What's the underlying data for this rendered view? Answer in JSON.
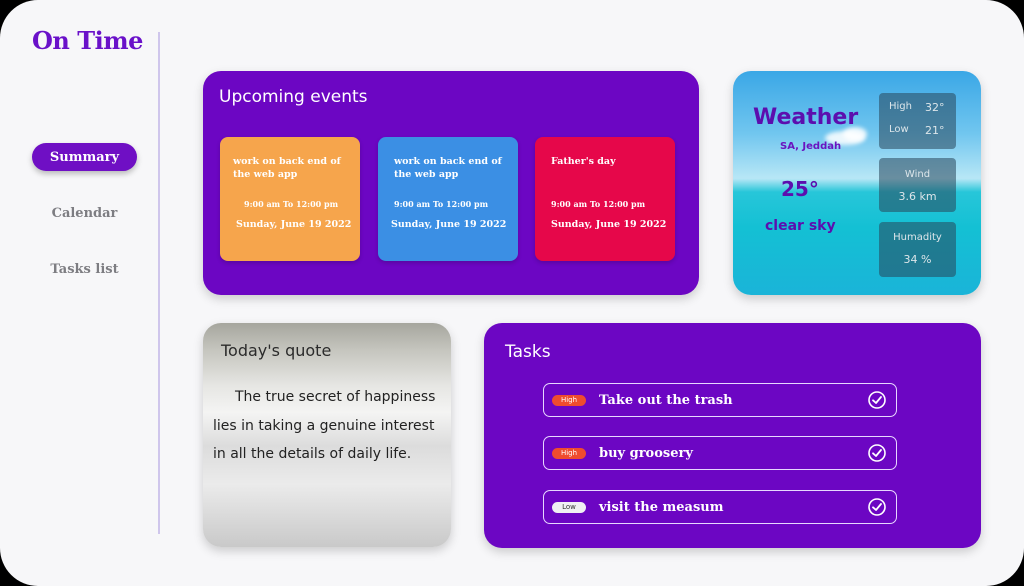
{
  "app": {
    "title": "On Time"
  },
  "nav": [
    {
      "label": "Summary",
      "active": true
    },
    {
      "label": "Calendar",
      "active": false
    },
    {
      "label": "Tasks list",
      "active": false
    }
  ],
  "events": {
    "title": "Upcoming events",
    "items": [
      {
        "title": "work on back end of the web app",
        "time": "9:00 am  To  12:00 pm",
        "date": "Sunday, June 19 2022",
        "color": "#f6a54c"
      },
      {
        "title": "work on back end of the web app",
        "time": "9:00 am  To  12:00 pm",
        "date": "Sunday, June 19 2022",
        "color": "#3b8fe4"
      },
      {
        "title": "Father's day",
        "time": "9:00 am  To  12:00 pm",
        "date": "Sunday, June 19 2022",
        "color": "#e6074a"
      }
    ]
  },
  "weather": {
    "title": "Weather",
    "location": "SA, Jeddah",
    "temperature": "25°",
    "description": "clear sky",
    "high_label": "High",
    "high_value": "32°",
    "low_label": "Low",
    "low_value": "21°",
    "wind_label": "Wind",
    "wind_value": "3.6 km",
    "humidity_label": "Humadity",
    "humidity_value": "34 %"
  },
  "quote": {
    "title": "Today's quote",
    "text": "The true secret of happiness lies in taking a genuine interest in all the details of daily life."
  },
  "tasks": {
    "title": "Tasks",
    "items": [
      {
        "priority": "High",
        "label": "Take out the trash",
        "done": true
      },
      {
        "priority": "High",
        "label": "buy groosery",
        "done": true
      },
      {
        "priority": "Low",
        "label": "visit the measum",
        "done": true
      }
    ]
  },
  "colors": {
    "accent": "#6c06c3",
    "high_badge": "#ef4c2e",
    "low_badge": "#f0f0f3"
  }
}
